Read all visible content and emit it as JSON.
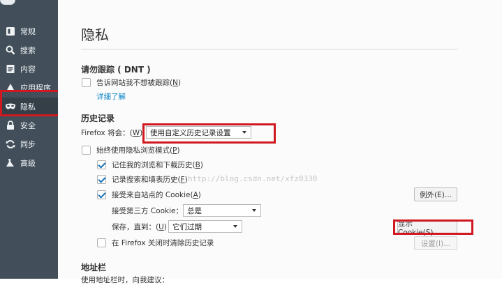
{
  "sidebar": {
    "items": [
      {
        "label": "常规",
        "icon": "general-icon"
      },
      {
        "label": "搜索",
        "icon": "search-icon"
      },
      {
        "label": "内容",
        "icon": "content-icon"
      },
      {
        "label": "应用程序",
        "icon": "applications-icon"
      },
      {
        "label": "隐私",
        "icon": "privacy-mask-icon",
        "active": true
      },
      {
        "label": "安全",
        "icon": "security-lock-icon"
      },
      {
        "label": "同步",
        "icon": "sync-icon"
      },
      {
        "label": "高级",
        "icon": "advanced-icon"
      }
    ]
  },
  "main": {
    "title": "隐私",
    "dnt": {
      "heading": "请勿跟踪 ( DNT )",
      "checkbox_label": "告诉网站我不想被跟踪(",
      "checkbox_key": "N",
      "checkbox_suffix": ")",
      "checked": false,
      "learn_more": "详细了解"
    },
    "history": {
      "heading": "历史记录",
      "firefox_will_prefix": "Firefox 将会：(",
      "firefox_will_key": "W",
      "firefox_will_suffix": ")",
      "mode_selected": "使用自定义历史记录设置",
      "private_mode_label": "始终使用隐私浏览模式(",
      "private_mode_key": "P",
      "private_mode_suffix": ")",
      "private_mode_checked": false,
      "remember_browsing": {
        "label": "记住我的浏览和下载历史(",
        "key": "B",
        "suffix": ")",
        "checked": true
      },
      "remember_search": {
        "label": "记录搜索和填表历史(",
        "key": "F",
        "suffix": ")",
        "checked": true
      },
      "accept_cookies": {
        "label": "接受来自站点的 Cookie(",
        "key": "A",
        "suffix": ")",
        "checked": true
      },
      "exceptions_button": "例外(E)...",
      "third_party_label": "接受第三方 Cookie：",
      "third_party_selected": "总是",
      "keep_until_prefix": "保存，直到：(",
      "keep_until_key": "U",
      "keep_until_suffix": ")",
      "keep_until_selected": "它们过期",
      "show_cookies_button": "显示 Cookie(S)...",
      "clear_on_close": {
        "label": "在 Firefox 关闭时清除历史记录",
        "checked": false
      },
      "settings_button": "设置(I)..."
    },
    "address_bar": {
      "heading": "地址栏",
      "partial_text": "使用地址栏时，向我建议："
    },
    "watermark": "http://blog.csdn.net/xfz0330"
  },
  "colors": {
    "sidebar_bg": "#424f5a",
    "sidebar_active_bg": "#343f48",
    "annotation_red": "#d01820",
    "link_blue": "#0a84c8"
  }
}
